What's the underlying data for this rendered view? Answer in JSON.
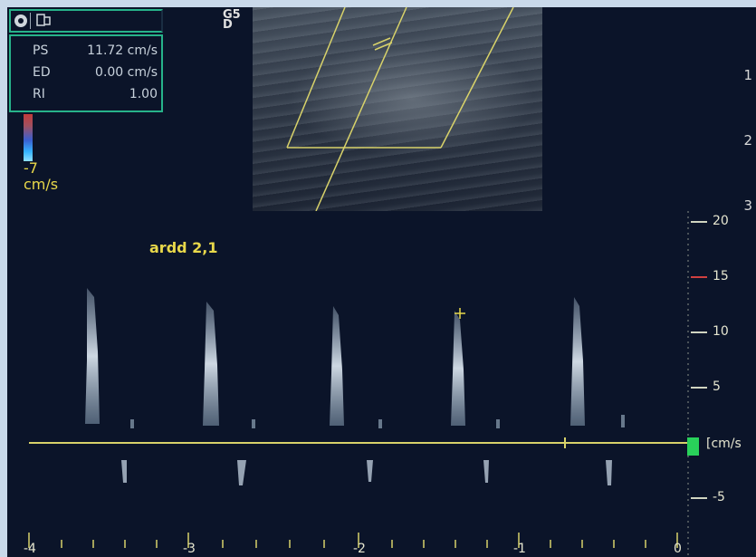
{
  "header": {
    "icon_left": "target-icon",
    "icon_right": "probe-icon"
  },
  "measurements": {
    "ps": {
      "label": "PS",
      "value": "11.72 cm/s"
    },
    "ed": {
      "label": "ED",
      "value": "0.00 cm/s"
    },
    "ri": {
      "label": "RI",
      "value": "1.00"
    }
  },
  "color_scale": {
    "min_label": "-7",
    "unit_label": "cm/s"
  },
  "image_2d": {
    "freq_label_top": "G5",
    "freq_label_bottom": "D",
    "depth_ticks": [
      "1",
      "2",
      "3"
    ]
  },
  "trace": {
    "label": "ardd 2,1"
  },
  "velocity_scale": {
    "ticks": [
      {
        "label": "20",
        "value": 20
      },
      {
        "label": "15",
        "value": 15
      },
      {
        "label": "10",
        "value": 10
      },
      {
        "label": "5",
        "value": 5
      },
      {
        "label": "-5",
        "value": -5
      }
    ],
    "unit_label": "[cm/s",
    "min": -9,
    "max": 22
  },
  "time_axis": {
    "labels": [
      "-4",
      "-3",
      "-2",
      "-1",
      "0"
    ]
  },
  "colors": {
    "accent_green": "#27b38a",
    "label_yellow": "#e8d84a",
    "baseline": "#d8d26a",
    "marker_red": "#d04040",
    "marker_green": "#29d15a"
  }
}
